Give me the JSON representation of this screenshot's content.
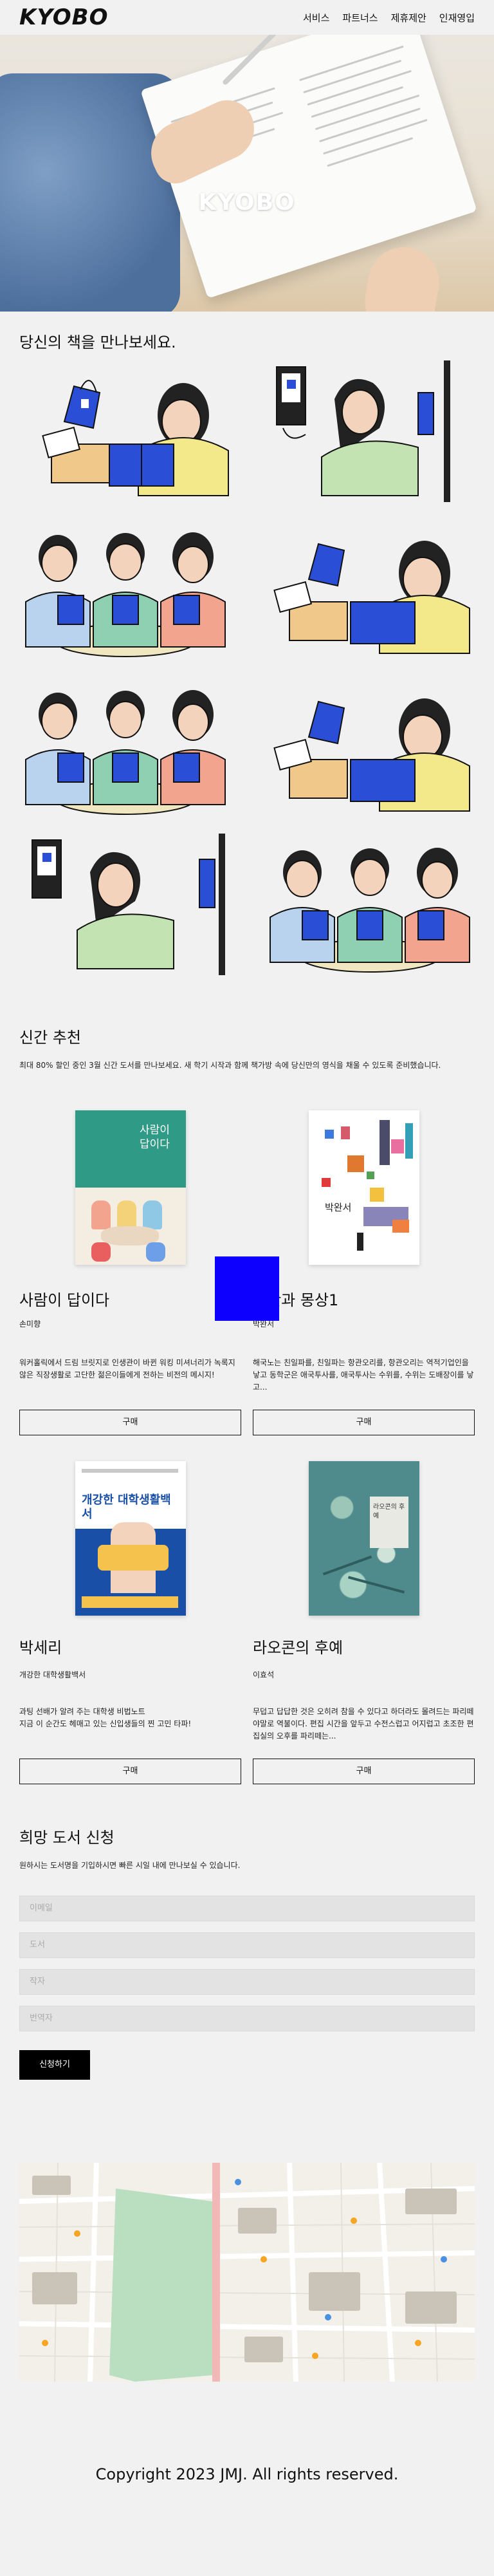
{
  "header": {
    "logo": "KYOBO",
    "nav": [
      "서비스",
      "파트너스",
      "제휴제안",
      "인재영입"
    ]
  },
  "hero": {
    "title": "KYOBO"
  },
  "intro": {
    "title": "당신의 책을 만나보세요."
  },
  "new_books": {
    "title": "신간 추천",
    "description": "최대 80% 할인 중인 3월 신간 도서를 만나보세요. 새 학기 시작과 함께 책가방 속에 당신만의 영식을 채울 수 있도록 준비했습니다.",
    "buy_label": "구매",
    "books": [
      {
        "title": "사람이 답이다",
        "author": "손미향",
        "desc": "워커홀릭에서 드림 브릿지로 인생관이 바뀐 워킹 미셔너리가 녹록지 않은 직장생활로 고단한 젊은이들에게 전하는 비전의 메시지!",
        "cover_title": "사람이\n답이다",
        "cover_color": "#2f9a86"
      },
      {
        "title": "오만과 몽상1",
        "author": "박완서",
        "desc": "해국노는 친일파를, 친일파는 항관오리를, 항관오리는 역적기업인을 낳고 동학군은 애국투사를, 애국투사는 수위를, 수위는 도배장이를 낳고...",
        "cover_title": "박완서",
        "cover_color": "#ffffff"
      },
      {
        "title": "박세리",
        "author": "개강한 대학생활백서",
        "desc": "과팅 선배가 알려 주는 대학생 비법노트\n지금 이 순간도 헤매고 있는 신입생들의 찐 고민 타파!",
        "cover_title": "개강한 대학생활백서",
        "cover_color": "#1a4fa8"
      },
      {
        "title": "라오콘의 후예",
        "author": "이효석",
        "desc": "무덥고 답답한 것은 오히려 참을 수 있다고 하더라도 몰려드는 파리떼야말로 역불이다. 편집 시간을 앞두고 수전스럽고 어지럽고 초조한 편집실의 오후를 파리떼는...",
        "cover_title": "라오콘의 후예",
        "cover_color": "#4f8a8c"
      }
    ]
  },
  "request": {
    "title": "희망 도서 신청",
    "description": "원하시는 도서명을 기입하시면 빠른 시일 내에 만나보실 수 있습니다.",
    "fields": [
      "이메일",
      "도서",
      "작자",
      "번역자"
    ],
    "submit": "신청하기"
  },
  "footer": {
    "text": "Copyright 2023 JMJ. All rights reserved."
  }
}
